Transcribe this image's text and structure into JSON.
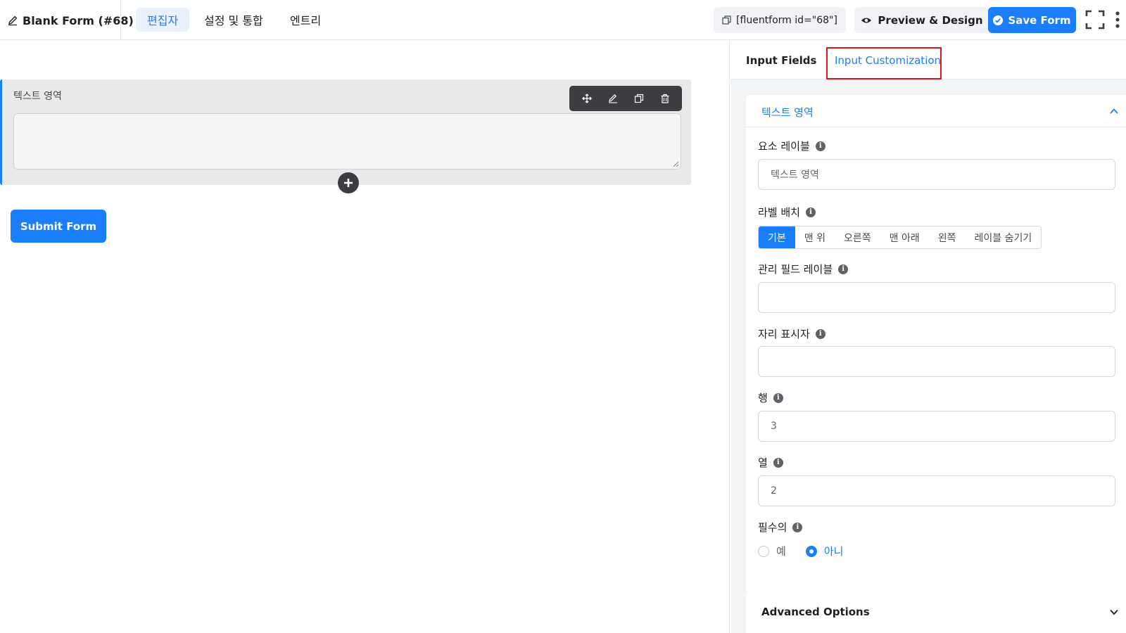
{
  "header": {
    "form_title": "Blank Form (#68)",
    "tabs": [
      {
        "label": "편집자",
        "active": true
      },
      {
        "label": "설정 및 통합",
        "active": false
      },
      {
        "label": "엔트리",
        "active": false
      }
    ],
    "shortcode": "[fluentform id=\"68\"]",
    "preview_label": "Preview & Design",
    "save_label": "Save Form"
  },
  "canvas": {
    "field_label": "텍스트 영역",
    "submit_label": "Submit Form",
    "toolbar_icons": [
      "move-icon",
      "edit-icon",
      "duplicate-icon",
      "trash-icon"
    ]
  },
  "sidebar": {
    "tabs": [
      {
        "label": "Input Fields",
        "active": false
      },
      {
        "label": "Input Customization",
        "active": true
      }
    ],
    "panel_title": "텍스트 영역",
    "element_label": {
      "label": "요소 레이블",
      "value": "텍스트 영역"
    },
    "label_placement": {
      "label": "라벨 배치",
      "options": [
        "기본",
        "맨 위",
        "오른쪽",
        "맨 아래",
        "왼쪽",
        "레이블 숨기기"
      ],
      "selected": "기본"
    },
    "admin_label": {
      "label": "관리 필드 레이블",
      "value": ""
    },
    "placeholder": {
      "label": "자리 표시자",
      "value": ""
    },
    "rows": {
      "label": "행",
      "value": "3"
    },
    "cols": {
      "label": "열",
      "value": "2"
    },
    "required": {
      "label": "필수의",
      "yes": "예",
      "no": "아니",
      "selected": "아니"
    },
    "advanced_title": "Advanced Options"
  },
  "colors": {
    "accent": "#1a7efb",
    "highlight_box": "#e0151b",
    "toolbar_bg": "#3b3d40"
  }
}
